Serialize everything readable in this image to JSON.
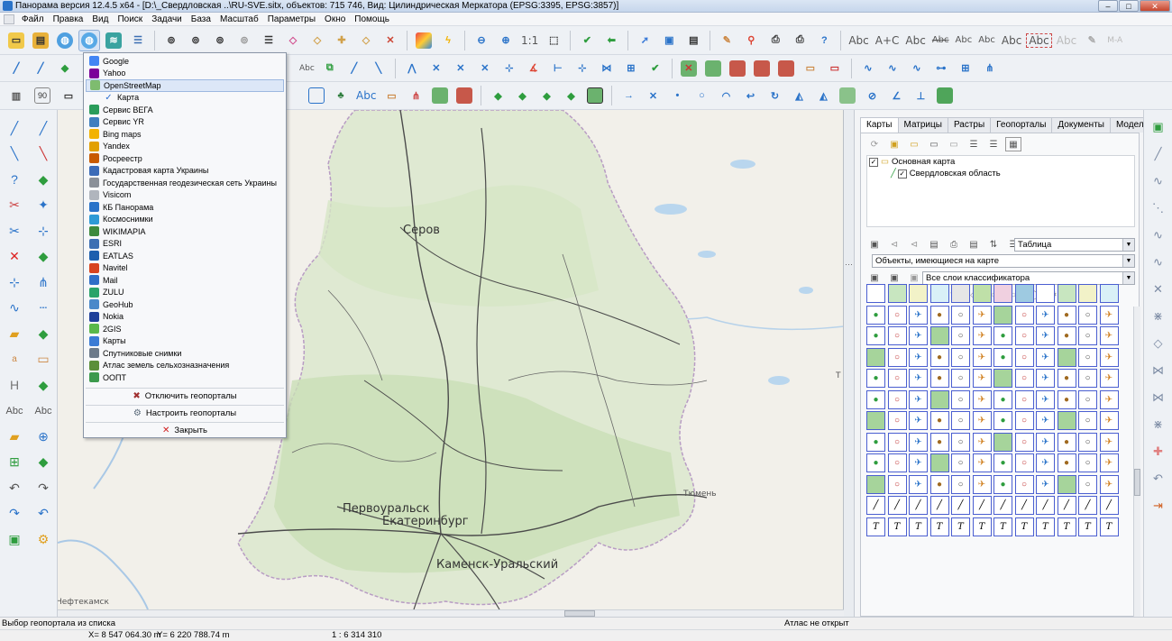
{
  "window": {
    "title": "Панорама версия 12.4.5 x64 - [D:\\_Свердловская ..\\RU-SVE.sitx, объектов: 715 746, Вид: Цилиндрическая Меркатора (EPSG:3395, EPSG:3857)]",
    "minimize": "–",
    "maximize": "□",
    "close": "✕"
  },
  "menu": [
    "Файл",
    "Правка",
    "Вид",
    "Поиск",
    "Задачи",
    "База",
    "Масштаб",
    "Параметры",
    "Окно",
    "Помощь"
  ],
  "toolbar": {
    "scale_label": "1:1",
    "text_tools": [
      "Abc",
      "A+C",
      "Abc",
      "Abc",
      "Abc",
      "Abc",
      "Abc",
      "Abc",
      "Abc",
      "M-A"
    ],
    "rotate_value": "90",
    "label_tool": "Abc"
  },
  "left_panel": {
    "text_tools": [
      "Abc",
      "Abc"
    ],
    "h_label": "H",
    "a_label": "a"
  },
  "geoportal_menu": {
    "items": [
      {
        "label": "Google",
        "icon": "google-icon",
        "color": "#4285f4"
      },
      {
        "label": "Yahoo",
        "icon": "yahoo-icon",
        "color": "#7b0099"
      },
      {
        "label": "OpenStreetMap",
        "icon": "osm-icon",
        "color": "#7ebc6f",
        "highlighted": true
      },
      {
        "label": "Карта",
        "icon": "check-icon",
        "color": "#2e6fd1",
        "sub": true
      },
      {
        "label": "Сервис ВЕГА",
        "icon": "vega-icon",
        "color": "#2a9c5a"
      },
      {
        "label": "Сервис YR",
        "icon": "yr-icon",
        "color": "#3f7fbf"
      },
      {
        "label": "Bing maps",
        "icon": "bing-icon",
        "color": "#f2b200"
      },
      {
        "label": "Yandex",
        "icon": "yandex-icon",
        "color": "#e2a000"
      },
      {
        "label": "Росреестр",
        "icon": "rosreestr-icon",
        "color": "#c85a00"
      },
      {
        "label": "Кадастровая карта Украины",
        "icon": "ukraine-cadastre-icon",
        "color": "#3b6bb8"
      },
      {
        "label": "Государственная геодезическая сеть Украины",
        "icon": "ukraine-geodesy-icon",
        "color": "#8a9099"
      },
      {
        "label": "Visicom",
        "icon": "visicom-icon",
        "color": "#b0b5bd"
      },
      {
        "label": "КБ Панорама",
        "icon": "panorama-icon",
        "color": "#2a73c9"
      },
      {
        "label": "Космоснимки",
        "icon": "kosmosnimki-icon",
        "color": "#2e9ad6"
      },
      {
        "label": "WIKIMAPIA",
        "icon": "wikimapia-icon",
        "color": "#3d8a3d"
      },
      {
        "label": "ESRI",
        "icon": "esri-icon",
        "color": "#3c6fb3"
      },
      {
        "label": "EATLAS",
        "icon": "eatlas-icon",
        "color": "#1d5fae"
      },
      {
        "label": "Navitel",
        "icon": "navitel-icon",
        "color": "#d8431f"
      },
      {
        "label": "Mail",
        "icon": "mail-icon",
        "color": "#2f6ec7"
      },
      {
        "label": "ZULU",
        "icon": "zulu-icon",
        "color": "#2aa36a"
      },
      {
        "label": "GeoHub",
        "icon": "geohub-icon",
        "color": "#4a88c9"
      },
      {
        "label": "Nokia",
        "icon": "nokia-icon",
        "color": "#20409a"
      },
      {
        "label": "2GIS",
        "icon": "2gis-icon",
        "color": "#59b84a"
      },
      {
        "label": "Карты",
        "icon": "maps-icon",
        "color": "#3a7bd5"
      },
      {
        "label": "Спутниковые снимки",
        "icon": "satellite-icon",
        "color": "#6c7a8a"
      },
      {
        "label": "Атлас земель сельхозназначения",
        "icon": "agro-atlas-icon",
        "color": "#5b8f3a"
      },
      {
        "label": "ООПТ",
        "icon": "oopt-icon",
        "color": "#3c9a4c"
      }
    ],
    "actions": [
      {
        "label": "Отключить геопорталы",
        "icon": "disconnect-icon"
      },
      {
        "label": "Настроить геопорталы",
        "icon": "settings-gear-icon"
      },
      {
        "label": "Закрыть",
        "icon": "close-icon"
      }
    ]
  },
  "map": {
    "labels": {
      "serov": "Серов",
      "pervouralsk": "Первоуральск",
      "ekaterinburg": "Екатеринбург",
      "kamensk": "Каменск-Уральский",
      "tyumen": "Тюмень",
      "neftekamsk": "Нефтекамск",
      "edge_t": "Т"
    }
  },
  "right_panel": {
    "tabs": [
      "Карты",
      "Матрицы",
      "Растры",
      "Геопорталы",
      "Документы",
      "Модели"
    ],
    "active_tab": "Карты",
    "tree": {
      "root": "Основная карта",
      "child": "Свердловская область"
    },
    "view_select": "Таблица",
    "objects_select": "Объекты, имеющиеся на карте",
    "layers_select": "Все слои классификатора"
  },
  "status": {
    "hint": "Выбор геопортала из списка",
    "atlas": "Атлас не открыт",
    "x": "X= 8 547 064.30 m",
    "y": "Y= 6 220 788.74 m",
    "scale": "1 : 6 314 310"
  }
}
